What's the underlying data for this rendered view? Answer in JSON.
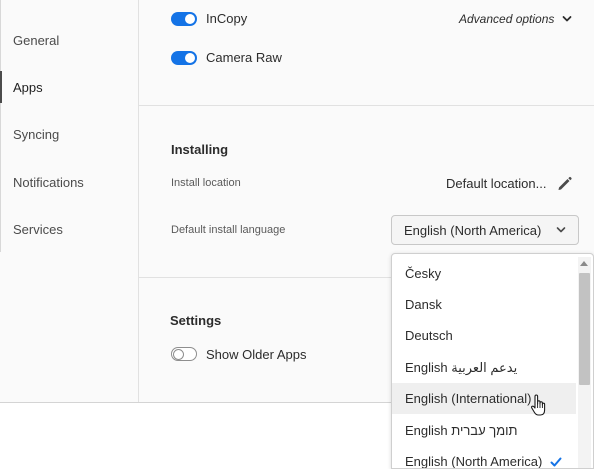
{
  "sidebar": {
    "items": [
      {
        "label": "General"
      },
      {
        "label": "Apps"
      },
      {
        "label": "Syncing"
      },
      {
        "label": "Notifications"
      },
      {
        "label": "Services"
      }
    ],
    "active": "Apps"
  },
  "apps": {
    "incopy": {
      "label": "InCopy",
      "enabled": true
    },
    "camera_raw": {
      "label": "Camera Raw",
      "enabled": true
    },
    "advanced_options": "Advanced options"
  },
  "installing": {
    "title": "Installing",
    "location_label": "Install location",
    "location_value": "Default location...",
    "language_label": "Default install language",
    "language_value": "English (North America)"
  },
  "settings": {
    "title": "Settings",
    "show_older_apps": {
      "label": "Show Older Apps",
      "enabled": false
    }
  },
  "language_dropdown": {
    "options": [
      {
        "label": "Česky"
      },
      {
        "label": "Dansk"
      },
      {
        "label": "Deutsch"
      },
      {
        "label": "English يدعم العربية"
      },
      {
        "label": "English (International)"
      },
      {
        "label": "English תומך עברית"
      },
      {
        "label": "English (North America)"
      }
    ],
    "hovered": "English (International)",
    "selected": "English (North America)"
  },
  "colors": {
    "accent": "#1473e6",
    "check": "#1473e6"
  }
}
